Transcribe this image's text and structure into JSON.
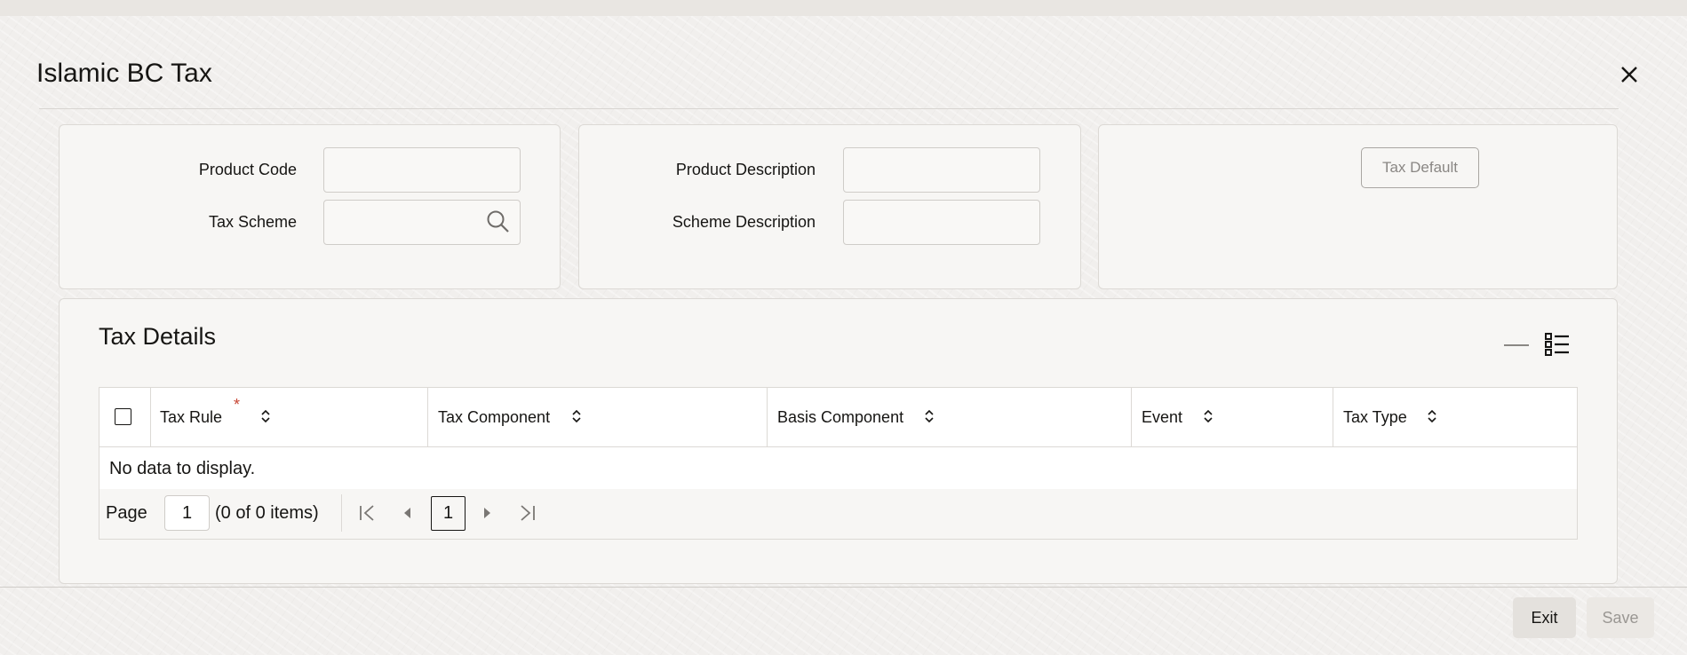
{
  "window": {
    "title": "Islamic BC Tax"
  },
  "header_form": {
    "product_code": {
      "label": "Product Code",
      "value": ""
    },
    "tax_scheme": {
      "label": "Tax Scheme",
      "value": ""
    },
    "product_description": {
      "label": "Product Description",
      "value": ""
    },
    "scheme_description": {
      "label": "Scheme Description",
      "value": ""
    },
    "tax_default_button": "Tax Default"
  },
  "tax_details": {
    "title": "Tax Details",
    "columns": [
      {
        "label": "Tax Rule",
        "required_mark": "*"
      },
      {
        "label": "Tax Component"
      },
      {
        "label": "Basis Component"
      },
      {
        "label": "Event"
      },
      {
        "label": "Tax Type"
      }
    ],
    "empty_message": "No data to display.",
    "pagination": {
      "page_label": "Page",
      "page_value": "1",
      "items_text": "(0 of 0 items)",
      "current_page": "1"
    }
  },
  "footer": {
    "exit_label": "Exit",
    "save_label": "Save"
  },
  "colors": {
    "required": "#c74634",
    "border": "#dcd9d5",
    "panel_bg": "#f7f6f4"
  }
}
